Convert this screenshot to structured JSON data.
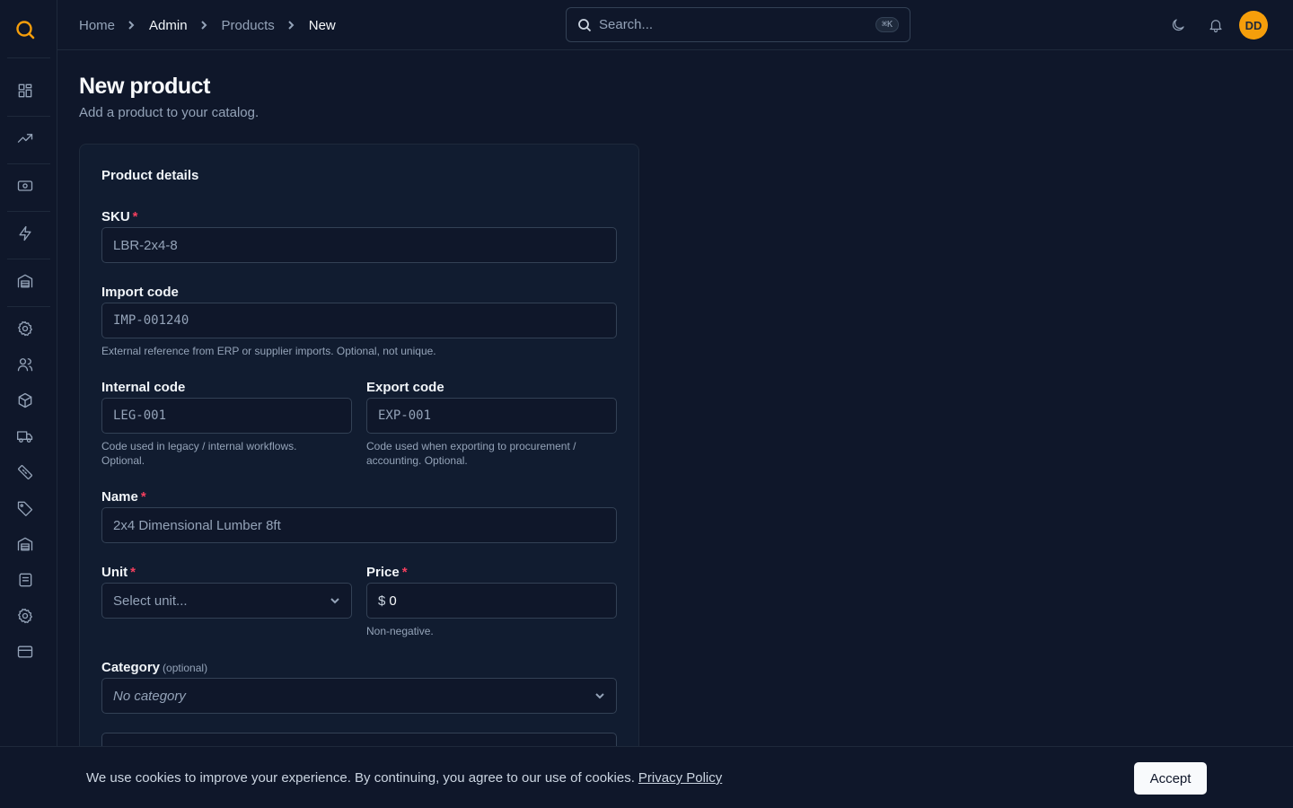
{
  "breadcrumb": [
    {
      "label": "Home"
    },
    {
      "label": "Admin"
    },
    {
      "label": "Products"
    },
    {
      "label": "New"
    }
  ],
  "search": {
    "placeholder": "Search...",
    "shortcut": "⌘K"
  },
  "user": {
    "initials": "DD"
  },
  "page": {
    "title": "New product",
    "subtitle": "Add a product to your catalog."
  },
  "form": {
    "section_title": "Product details",
    "sku": {
      "label": "SKU",
      "placeholder": "LBR-2x4-8"
    },
    "import_code": {
      "label": "Import code",
      "placeholder": "IMP-001240",
      "help": "External reference from ERP or supplier imports. Optional, not unique."
    },
    "internal_code": {
      "label": "Internal code",
      "placeholder": "LEG-001",
      "help_line1": "Code used in legacy / internal workflows.",
      "help_line2": "Optional."
    },
    "export_code": {
      "label": "Export code",
      "placeholder": "EXP-001",
      "help_line1": "Code used when exporting to procurement /",
      "help_line2": "accounting. Optional."
    },
    "name": {
      "label": "Name",
      "placeholder": "2x4 Dimensional Lumber 8ft"
    },
    "unit": {
      "label": "Unit",
      "placeholder": "Select unit..."
    },
    "price": {
      "label": "Price",
      "currency": "$",
      "value": "0",
      "help": "Non-negative."
    },
    "category": {
      "label": "Category",
      "optional": "(optional)",
      "value": "No category"
    },
    "required_mark": "*"
  },
  "cookie": {
    "text": "We use cookies to improve your experience. By continuing, you agree to our use of cookies.",
    "link": "Privacy Policy",
    "accept": "Accept"
  },
  "colors": {
    "accent": "#f59e0b",
    "background": "#0f172a",
    "required": "#f43f5e"
  }
}
